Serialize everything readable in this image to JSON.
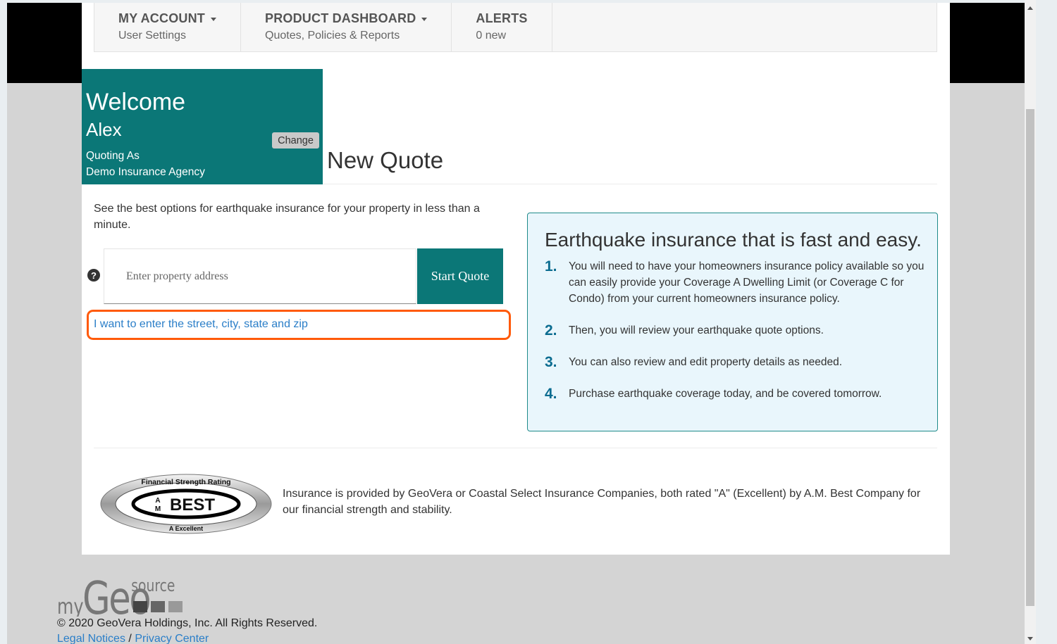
{
  "nav": {
    "items": [
      {
        "title": "MY ACCOUNT",
        "subtitle": "User Settings",
        "has_caret": true
      },
      {
        "title": "PRODUCT DASHBOARD",
        "subtitle": "Quotes, Policies & Reports",
        "has_caret": true
      },
      {
        "title": "ALERTS",
        "subtitle": "0 new",
        "has_caret": false
      }
    ]
  },
  "welcome": {
    "title": "Welcome",
    "name": "Alex",
    "quoting_as_label": "Quoting As",
    "agency": "Demo Insurance Agency",
    "change_label": "Change"
  },
  "page_title": "New Quote",
  "quote_form": {
    "intro": "See the best options for earthquake insurance for your property in less than a minute.",
    "help_icon": "question-circle-icon",
    "address_placeholder": "Enter property address",
    "address_value": "",
    "start_button": "Start Quote",
    "manual_entry_link": "I want to enter the street, city, state and zip"
  },
  "info_box": {
    "title": "Earthquake insurance that is fast and easy.",
    "steps": [
      {
        "num": "1.",
        "text": "You will need to have your homeowners insurance policy available so you can easily provide your Coverage A Dwelling Limit (or Coverage C for Condo) from your current homeowners insurance policy."
      },
      {
        "num": "2.",
        "text": "Then, you will review your earthquake quote options."
      },
      {
        "num": "3.",
        "text": "You can also review and edit property details as needed."
      },
      {
        "num": "4.",
        "text": "Purchase earthquake coverage today, and be covered tomorrow."
      }
    ]
  },
  "rating": {
    "badge_top": "Financial Strength Rating",
    "badge_mid_a": "A",
    "badge_mid_m": "M",
    "badge_mid_best": "BEST",
    "badge_bottom": "A Excellent",
    "text": "Insurance is provided by GeoVera or Coastal Select Insurance Companies, both rated \"A\" (Excellent) by A.M. Best Company for our financial strength and stability."
  },
  "footer": {
    "logo_my": "my",
    "logo_geo": "Geo",
    "logo_source": "source",
    "copyright": "© 2020 GeoVera Holdings, Inc. All Rights Reserved.",
    "legal_link": "Legal Notices",
    "separator": "/",
    "privacy_link": "Privacy Center"
  },
  "colors": {
    "brand_teal": "#0b7777",
    "link_blue": "#2a7ec8",
    "highlight_orange": "#ff5a0a",
    "info_bg": "#e9f6fc",
    "step_number": "#0b6c90"
  }
}
